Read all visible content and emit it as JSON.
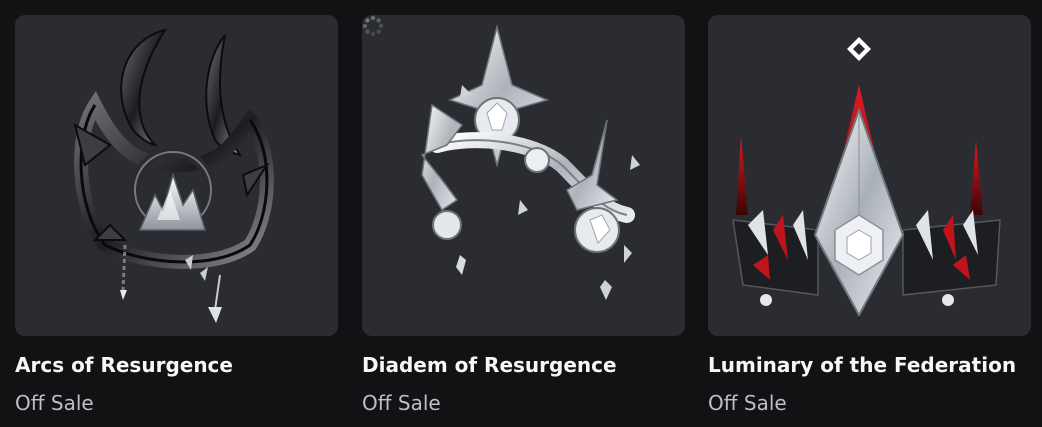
{
  "items": [
    {
      "name": "Arcs of Resurgence",
      "status": "Off Sale",
      "thumbnail_icon": "dark-horned-crown-image",
      "loading": false
    },
    {
      "name": "Diadem of Resurgence",
      "status": "Off Sale",
      "thumbnail_icon": "silver-crystal-diadem-image",
      "loading": true
    },
    {
      "name": "Luminary of the Federation",
      "status": "Off Sale",
      "thumbnail_icon": "silver-red-spiked-crown-image",
      "loading": false
    }
  ],
  "colors": {
    "page_bg": "#121215",
    "card_bg": "#2b2c32",
    "title": "#f7f7f8",
    "status": "#bcbec8",
    "accent_red": "#c0141c"
  }
}
